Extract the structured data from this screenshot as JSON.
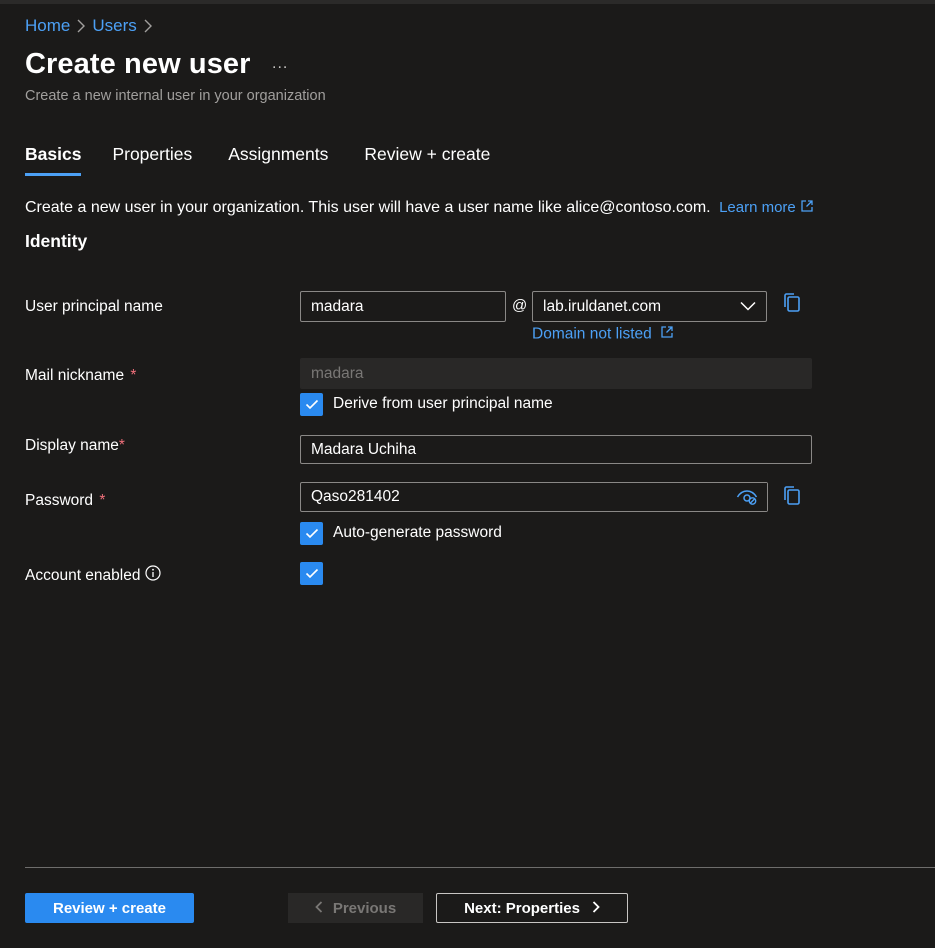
{
  "breadcrumb": {
    "items": [
      "Home",
      "Users"
    ]
  },
  "page": {
    "title": "Create new user",
    "more": "...",
    "subtitle": "Create a new internal user in your organization"
  },
  "tabs": [
    {
      "label": "Basics",
      "active": true
    },
    {
      "label": "Properties",
      "active": false
    },
    {
      "label": "Assignments",
      "active": false
    },
    {
      "label": "Review + create",
      "active": false
    }
  ],
  "intro": {
    "text": "Create a new user in your organization. This user will have a user name like alice@contoso.com.",
    "learn_more": "Learn more"
  },
  "section": {
    "title": "Identity"
  },
  "form": {
    "upn": {
      "label": "User principal name",
      "value": "madara",
      "at": "@",
      "domain": "lab.iruldanet.com",
      "domain_link": "Domain not listed"
    },
    "mail_nickname": {
      "label": "Mail nickname",
      "required": "*",
      "value": "madara",
      "derive_label": "Derive from user principal name",
      "derive_checked": true
    },
    "display_name": {
      "label": "Display name",
      "required": "*",
      "value": "Madara Uchiha"
    },
    "password": {
      "label": "Password",
      "required": "*",
      "value": "Qaso281402",
      "auto_label": "Auto-generate password",
      "auto_checked": true
    },
    "account_enabled": {
      "label": "Account enabled",
      "checked": true
    }
  },
  "footer": {
    "review_create": "Review + create",
    "previous": "Previous",
    "next": "Next: Properties"
  },
  "colors": {
    "accent": "#2a8af0",
    "link": "#4ca0f5",
    "background": "#1b1a19",
    "required": "#f1707b"
  }
}
